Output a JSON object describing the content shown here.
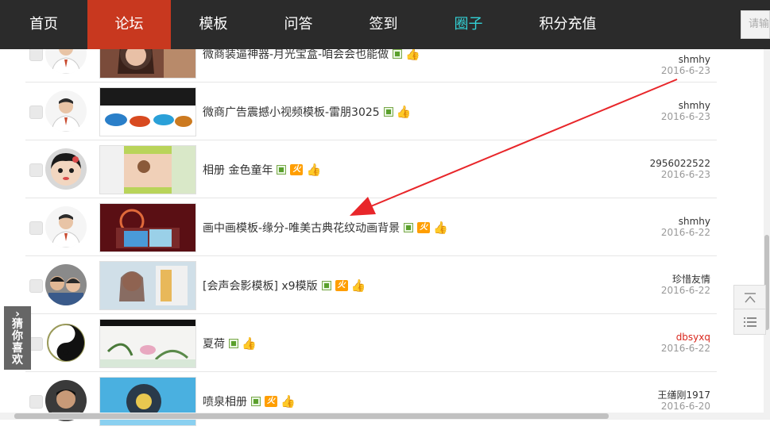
{
  "nav": {
    "items": [
      "首页",
      "论坛",
      "模板",
      "问答",
      "签到",
      "圈子",
      "积分充值"
    ],
    "search_placeholder": "请输",
    "active_color": "#c8381f",
    "accent_color": "#33d1d6"
  },
  "posts": [
    {
      "title": "微商装逼神器-月光宝盒-咱会会也能做",
      "author": "shmhy",
      "date": "2016-6-23",
      "hot": false
    },
    {
      "title": "微商广告震撼小视频模板-雷朋3025",
      "author": "shmhy",
      "date": "2016-6-23",
      "hot": false
    },
    {
      "title": "相册 金色童年",
      "author": "2956022522",
      "date": "2016-6-23",
      "hot": true
    },
    {
      "title": "画中画模板-缘分-唯美古典花纹动画背景",
      "author": "shmhy",
      "date": "2016-6-22",
      "hot": true
    },
    {
      "title": "[会声会影模板] x9模版",
      "author": "珍惜友情",
      "date": "2016-6-22",
      "hot": true
    },
    {
      "title": "夏荷",
      "author": "dbsyxq",
      "date": "2016-6-22",
      "hot": false,
      "author_color": "#d9261c"
    },
    {
      "title": "喷泉相册",
      "author": "王缮刚1917",
      "date": "2016-6-20",
      "hot": true
    }
  ],
  "badges": {
    "hot_label": "火"
  },
  "side": {
    "guess_label": "猜你喜欢",
    "guess_arrow": "›",
    "top_icon": "back-to-top-icon",
    "list_icon": "list-icon"
  }
}
